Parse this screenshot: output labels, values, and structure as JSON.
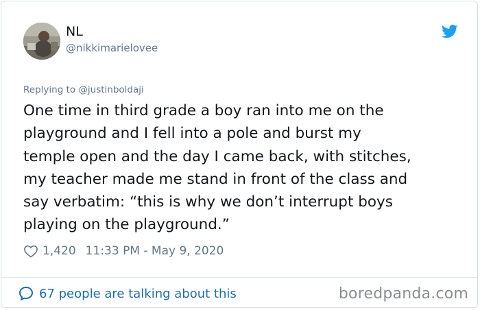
{
  "tweet": {
    "author": {
      "display_name": "NL",
      "handle": "@nikkimarielovee",
      "avatar_icon": "profile-photo"
    },
    "brand_icon": "twitter-bird-icon",
    "brand_color": "#1da1f2",
    "replying_to": "Replying to @justinboldaji",
    "text_lines": [
      "One time in third grade a boy ran into me on the",
      "playground and I fell into a pole and burst my",
      "temple open and the day I came back, with stitches,",
      "my teacher made me stand in front of the class and",
      "say verbatim: “this is why we don’t interrupt boys",
      "playing on the playground.”"
    ],
    "likes": "1,420",
    "timestamp": "11:33 PM - May 9, 2020",
    "like_icon": "heart-icon"
  },
  "footer": {
    "talking_label": "67 people are talking about this",
    "talking_icon": "speech-bubble-icon",
    "link_color": "#1b6bb8",
    "watermark": "boredpanda.com"
  }
}
